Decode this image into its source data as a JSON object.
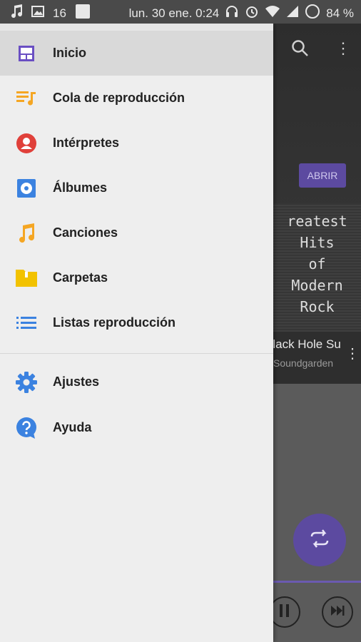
{
  "status_bar": {
    "left_number": "16",
    "datetime": "lun. 30 ene. 0:24",
    "battery": "84 %"
  },
  "background": {
    "open_button": "ABRIR",
    "album_art_text": [
      "reatest",
      "Hits",
      "of",
      "Modern",
      "Rock"
    ],
    "song_title": "Black Hole Sun",
    "artist": "Soundgarden"
  },
  "drawer": {
    "items": [
      {
        "label": "Inicio",
        "icon": "home-icon",
        "color": "#6a4fc3",
        "active": true
      },
      {
        "label": "Cola de reproducción",
        "icon": "queue-music-icon",
        "color": "#f5a623"
      },
      {
        "label": "Intérpretes",
        "icon": "artist-icon",
        "color": "#e0403a"
      },
      {
        "label": "Álbumes",
        "icon": "album-icon",
        "color": "#3b82e0"
      },
      {
        "label": "Canciones",
        "icon": "music-note-icon",
        "color": "#f5a623"
      },
      {
        "label": "Carpetas",
        "icon": "folder-icon",
        "color": "#f2c200"
      },
      {
        "label": "Listas reproducción",
        "icon": "playlist-icon",
        "color": "#3b82e0"
      },
      {
        "label": "Ajustes",
        "icon": "settings-gear-icon",
        "color": "#3b82e0"
      },
      {
        "label": "Ayuda",
        "icon": "help-icon",
        "color": "#3b82e0"
      }
    ]
  }
}
